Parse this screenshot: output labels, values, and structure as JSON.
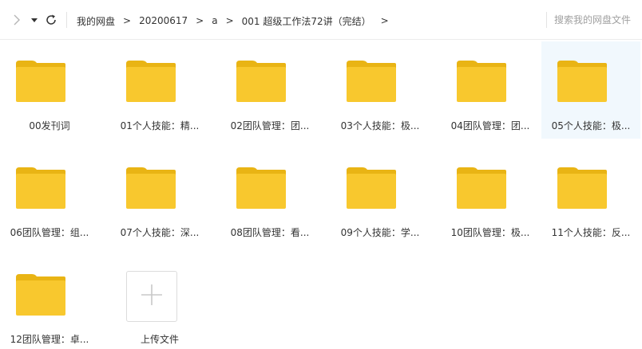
{
  "toolbar": {
    "forward_icon": "chevron-right-icon",
    "dropdown_icon": "caret-down-icon",
    "refresh_icon": "refresh-icon"
  },
  "breadcrumb": {
    "items": [
      "我的网盘",
      "20200617",
      "a",
      "001 超级工作法72讲（完结）"
    ],
    "separator": ">"
  },
  "search": {
    "placeholder": "搜索我的网盘文件"
  },
  "colors": {
    "folder": "#f8c82e",
    "folder_tab": "#e9b414",
    "selected_bg": "#f1f8fd"
  },
  "files": [
    {
      "name": "00发刊词",
      "type": "folder"
    },
    {
      "name": "01个人技能：精...",
      "type": "folder"
    },
    {
      "name": "02团队管理：团...",
      "type": "folder"
    },
    {
      "name": "03个人技能：极...",
      "type": "folder"
    },
    {
      "name": "04团队管理：团...",
      "type": "folder"
    },
    {
      "name": "05个人技能：极...",
      "type": "folder",
      "selected": true
    },
    {
      "name": "06团队管理：组...",
      "type": "folder"
    },
    {
      "name": "07个人技能：深...",
      "type": "folder"
    },
    {
      "name": "08团队管理：看...",
      "type": "folder"
    },
    {
      "name": "09个人技能：学...",
      "type": "folder"
    },
    {
      "name": "10团队管理：极...",
      "type": "folder"
    },
    {
      "name": "11个人技能：反...",
      "type": "folder"
    },
    {
      "name": "12团队管理：卓...",
      "type": "folder"
    }
  ],
  "upload": {
    "label": "上传文件",
    "icon": "plus-icon"
  }
}
